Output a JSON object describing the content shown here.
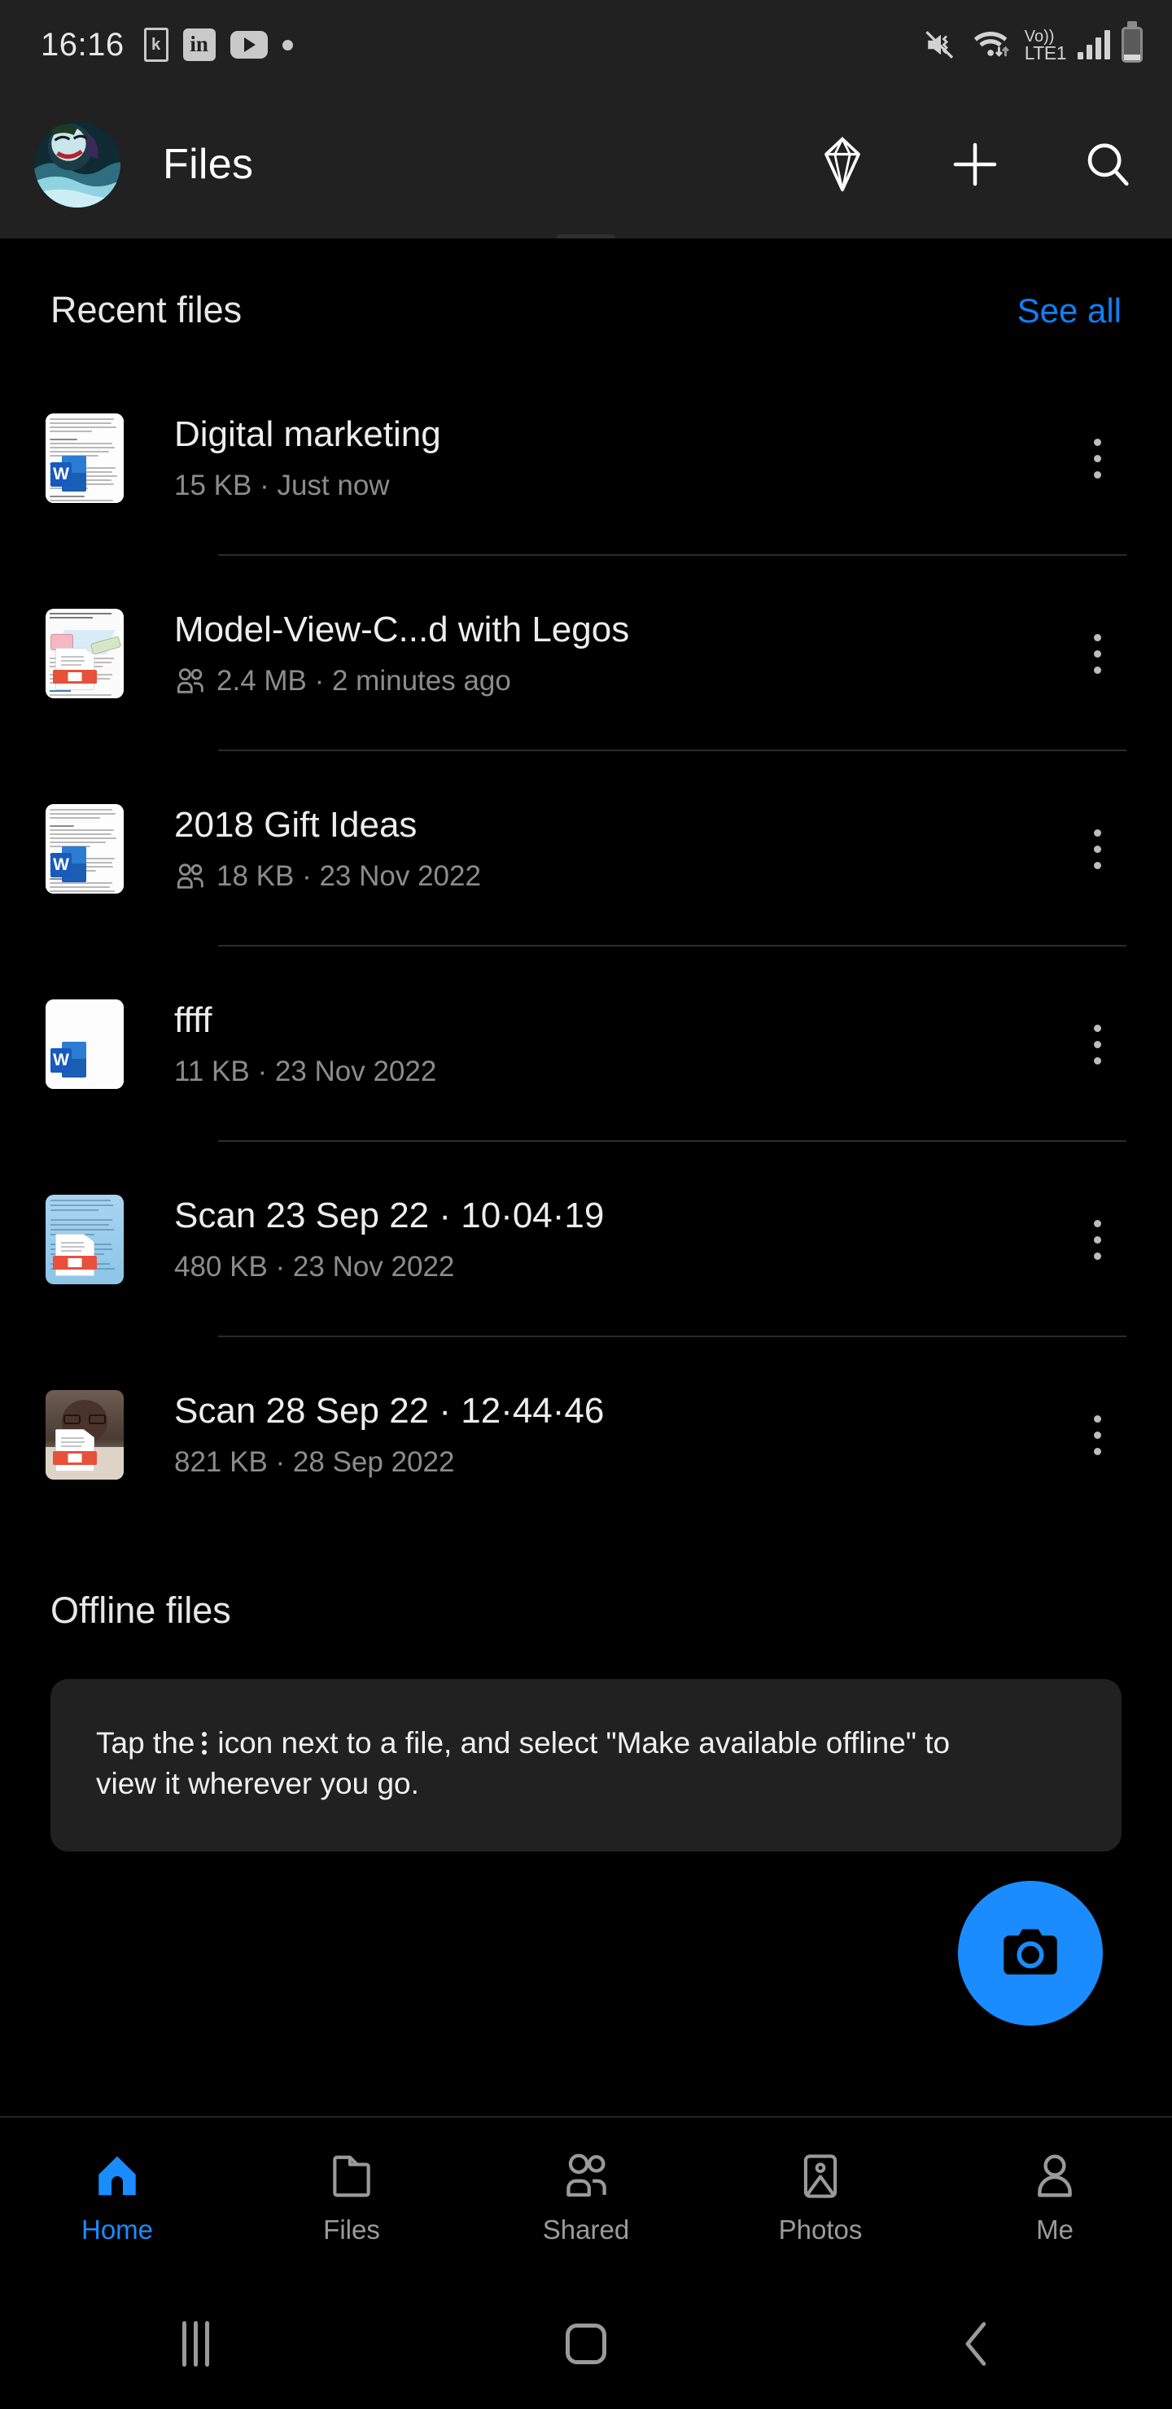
{
  "statusbar": {
    "clock": "16:16",
    "notification_icons": [
      "kindle-icon",
      "linkedin-icon",
      "youtube-icon",
      "dot-icon"
    ],
    "kindle_letter": "k",
    "linkedin_letter": "in",
    "mute_icon": "mute-vibrate-icon",
    "wifi_icon": "wifi-data-icon",
    "volte_line1": "Vo))",
    "volte_line2": "LTE1",
    "signal_icon": "signal-bars-icon",
    "battery_icon": "battery-low-icon"
  },
  "appbar": {
    "title": "Files",
    "avatar_name": "user-avatar",
    "premium_icon": "diamond-icon",
    "add_icon": "plus-icon",
    "search_icon": "search-icon"
  },
  "recent": {
    "section_title": "Recent files",
    "see_all": "See all",
    "files": [
      {
        "name": "Digital marketing",
        "meta": "15 KB · Just now",
        "shared": false,
        "thumb": "word-doc-thumbnail"
      },
      {
        "name": "Model-View-C...d with Legos",
        "meta": "2.4 MB · 2 minutes ago",
        "shared": true,
        "thumb": "pdf-article-thumbnail"
      },
      {
        "name": "2018 Gift Ideas",
        "meta": "18 KB · 23 Nov 2022",
        "shared": true,
        "thumb": "word-doc-thumbnail"
      },
      {
        "name": "ffff",
        "meta": "11 KB · 23 Nov 2022",
        "shared": false,
        "thumb": "word-blank-thumbnail"
      },
      {
        "name": "Scan 23 Sep 22 · 10·04·19",
        "meta": "480 KB · 23 Nov 2022",
        "shared": false,
        "thumb": "pdf-scan-blue-thumbnail"
      },
      {
        "name": "Scan 28 Sep 22 · 12·44·46",
        "meta": "821 KB · 28 Sep 2022",
        "shared": false,
        "thumb": "pdf-scan-photo-thumbnail"
      }
    ]
  },
  "offline": {
    "section_title": "Offline files",
    "hint_before": "Tap the",
    "hint_after": "icon next to a file, and select \"Make available offline\" to view it wherever you go."
  },
  "fab": {
    "icon": "camera-icon"
  },
  "bottom_nav": {
    "items": [
      {
        "label": "Home",
        "icon": "home-icon",
        "active": true
      },
      {
        "label": "Files",
        "icon": "folder-icon",
        "active": false
      },
      {
        "label": "Shared",
        "icon": "people-icon",
        "active": false
      },
      {
        "label": "Photos",
        "icon": "image-icon",
        "active": false
      },
      {
        "label": "Me",
        "icon": "person-icon",
        "active": false
      }
    ]
  },
  "android_nav": {
    "recents_icon": "recents-icon",
    "home_icon": "home-square-icon",
    "back_icon": "back-chevron-icon"
  },
  "colors": {
    "accent": "#1a8cff",
    "link": "#0f7ff5",
    "surface": "#212121",
    "background": "#000000"
  }
}
